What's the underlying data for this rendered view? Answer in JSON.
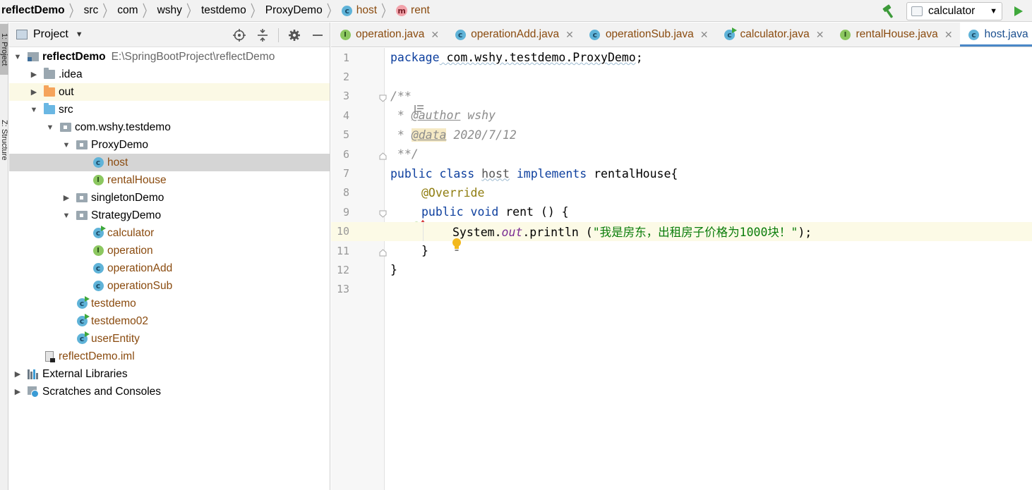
{
  "breadcrumbs": [
    {
      "label": "reflectDemo",
      "icon": "none",
      "style": "first"
    },
    {
      "label": "src",
      "icon": "none",
      "style": "plain"
    },
    {
      "label": "com",
      "icon": "none",
      "style": "plain"
    },
    {
      "label": "wshy",
      "icon": "none",
      "style": "plain"
    },
    {
      "label": "testdemo",
      "icon": "none",
      "style": "plain"
    },
    {
      "label": "ProxyDemo",
      "icon": "none",
      "style": "plain"
    },
    {
      "label": "host",
      "icon": "class-icon",
      "style": "host"
    },
    {
      "label": "rent",
      "icon": "method-icon",
      "style": "rent"
    }
  ],
  "toolbar": {
    "run_config": "calculator"
  },
  "side_tabs": {
    "project": "1: Project",
    "structure": "Z: Structure"
  },
  "project_panel": {
    "title": "Project"
  },
  "tree": [
    {
      "label": "reflectDemo",
      "path": "E:\\SpringBootProject\\reflectDemo",
      "icon": "project-folder-icon",
      "depth": 0,
      "arrow": "open",
      "bold": true
    },
    {
      "label": ".idea",
      "icon": "folder-grey-icon",
      "depth": 1,
      "arrow": "closed"
    },
    {
      "label": "out",
      "icon": "folder-orange-icon",
      "depth": 1,
      "arrow": "closed",
      "highlight": true
    },
    {
      "label": "src",
      "icon": "folder-blue-icon",
      "depth": 1,
      "arrow": "open"
    },
    {
      "label": "com.wshy.testdemo",
      "icon": "package-icon",
      "depth": 2,
      "arrow": "open"
    },
    {
      "label": "ProxyDemo",
      "icon": "package-icon",
      "depth": 3,
      "arrow": "open"
    },
    {
      "label": "host",
      "icon": "class-icon",
      "depth": 4,
      "arrow": "none",
      "brown": true,
      "selected": true
    },
    {
      "label": "rentalHouse",
      "icon": "interface-icon",
      "depth": 4,
      "arrow": "none",
      "brown": true
    },
    {
      "label": "singletonDemo",
      "icon": "package-icon",
      "depth": 3,
      "arrow": "closed"
    },
    {
      "label": "StrategyDemo",
      "icon": "package-icon",
      "depth": 3,
      "arrow": "open"
    },
    {
      "label": "calculator",
      "icon": "runnable-class-icon",
      "depth": 4,
      "arrow": "none",
      "brown": true
    },
    {
      "label": "operation",
      "icon": "interface-icon",
      "depth": 4,
      "arrow": "none",
      "brown": true
    },
    {
      "label": "operationAdd",
      "icon": "class-icon",
      "depth": 4,
      "arrow": "none",
      "brown": true
    },
    {
      "label": "operationSub",
      "icon": "class-icon",
      "depth": 4,
      "arrow": "none",
      "brown": true
    },
    {
      "label": "testdemo",
      "icon": "runnable-class-icon",
      "depth": 3,
      "arrow": "none",
      "brown": true,
      "flat": true
    },
    {
      "label": "testdemo02",
      "icon": "runnable-class-icon",
      "depth": 3,
      "arrow": "none",
      "brown": true,
      "flat": true
    },
    {
      "label": "userEntity",
      "icon": "runnable-class-icon",
      "depth": 3,
      "arrow": "none",
      "brown": true,
      "flat": true
    },
    {
      "label": "reflectDemo.iml",
      "icon": "iml-file-icon",
      "depth": 1,
      "arrow": "none",
      "brown": true,
      "flat": true
    },
    {
      "label": "External Libraries",
      "icon": "libraries-icon",
      "depth": 0,
      "arrow": "closed"
    },
    {
      "label": "Scratches and Consoles",
      "icon": "scratches-icon",
      "depth": 0,
      "arrow": "closed"
    }
  ],
  "tabs": [
    {
      "label": "operation.java",
      "icon": "interface-icon",
      "color": "brown"
    },
    {
      "label": "operationAdd.java",
      "icon": "class-icon",
      "color": "brown"
    },
    {
      "label": "operationSub.java",
      "icon": "class-icon",
      "color": "brown"
    },
    {
      "label": "calculator.java",
      "icon": "runnable-class-icon",
      "color": "brown"
    },
    {
      "label": "rentalHouse.java",
      "icon": "interface-icon",
      "color": "brown"
    },
    {
      "label": "host.java",
      "icon": "class-icon",
      "color": "blue",
      "active": true
    }
  ],
  "code": {
    "l1_kw": "package",
    "l1_pkg": " com.wshy.testdemo.ProxyDemo",
    "l1_semi": ";",
    "l3": "/**",
    "l4_pre": " * ",
    "l4_tag": "@author",
    "l4_val": " wshy",
    "l5_pre": " * ",
    "l5_tag": "@data",
    "l5_val": " 2020/7/12",
    "l6": " **/",
    "l7_kw1": "public",
    "l7_kw2": " class ",
    "l7_name": "host",
    "l7_kw3": " implements",
    "l7_rest": " rentalHouse{",
    "l8": "@Override",
    "l9_kw": "public void",
    "l9_rest": " rent () {",
    "l10_sys": "System.",
    "l10_out": "out",
    "l10_call": ".println (",
    "l10_str": "\"我是房东，出租房子价格为1000块！\"",
    "l10_end": ");",
    "l11": "}",
    "l12": "}"
  },
  "colors": {
    "accent": "#4a88c7",
    "class_icon": "#5fb3d8",
    "interface_icon": "#8cc760",
    "keyword": "#0d3f9e",
    "string": "#0b7d0b"
  }
}
